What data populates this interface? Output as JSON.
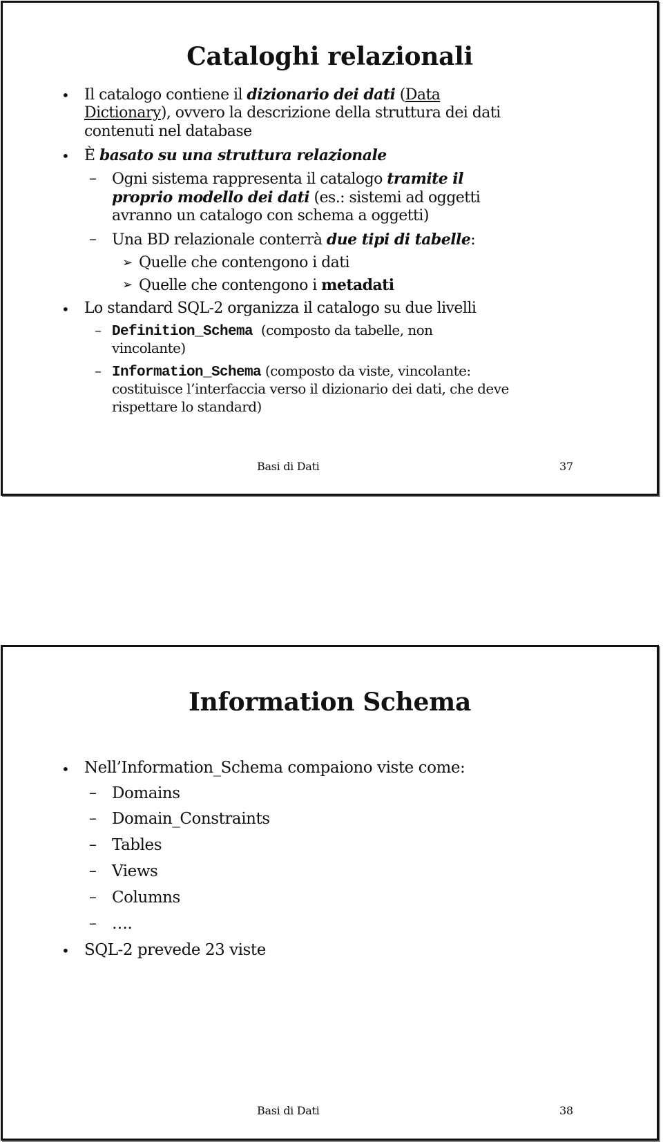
{
  "slides": [
    {
      "title": "Cataloghi relazionali",
      "bullets": {
        "b1": {
          "l1_a": "Il catalogo contiene il ",
          "l1_b": "dizionario dei dati",
          "l1_c": " (",
          "l1_d": "Data",
          "l2_a": "Dictionary",
          "l2_b": "), ovvero la descrizione della struttura dei dati",
          "l3": "contenuti nel database"
        },
        "b2": {
          "l1_a": "È ",
          "l1_b": "basato su una struttura relazionale",
          "sub1": {
            "l1_a": "Ogni sistema rappresenta il catalogo ",
            "l1_b": "tramite il",
            "l2_a": "proprio modello dei dati",
            "l2_b": " (es.: sistemi ad oggetti",
            "l3": "avranno un catalogo con schema a oggetti)"
          },
          "sub2": {
            "l1_a": "Una BD relazionale conterrà ",
            "l1_b": "due tipi di tabelle",
            "l1_c": ":",
            "items": [
              {
                "text": "Quelle che contengono i dati"
              },
              {
                "text_a": "Quelle che contengono i ",
                "text_b": "metadati"
              }
            ]
          }
        },
        "b3": {
          "l1": "Lo standard SQL-2 organizza il catalogo su due livelli",
          "sub1": {
            "code": "Definition_Schema",
            "l1_rest": " (composto da tabelle, non",
            "l2": "vincolante)"
          },
          "sub2": {
            "code": "Information_Schema",
            "l1_rest": " (composto da viste, vincolante:",
            "l2": "costituisce l’interfaccia verso il dizionario dei dati, che deve",
            "l3": "rispettare lo standard)"
          }
        }
      },
      "footer": {
        "course": "Basi di Dati",
        "page": "37"
      }
    },
    {
      "title": "Information Schema",
      "intro": "Nell’Information_Schema compaiono viste come:",
      "views": [
        "Domains",
        "Domain_Constraints",
        "Tables",
        "Views",
        "Columns",
        "…."
      ],
      "closing": "SQL-2 prevede 23 viste",
      "footer": {
        "course": "Basi di Dati",
        "page": "38"
      }
    }
  ],
  "symbols": {
    "bullet": "•",
    "dash": "–",
    "arrow": "➢"
  }
}
